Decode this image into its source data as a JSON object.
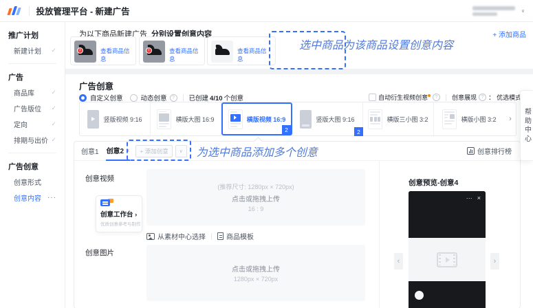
{
  "colors": {
    "accent": "#3370ff",
    "annotation": "#4f7bdf",
    "badge_orange": "#ff8800"
  },
  "icons": {
    "check": "✓",
    "caret_down": "∨",
    "more": "···",
    "chevron_right": "›",
    "nav_left": "‹",
    "nav_right": "›",
    "dots": "···",
    "close": "×",
    "info": "?"
  },
  "header": {
    "title": "投放管理平台 - 新建广告"
  },
  "sidebar": {
    "sections": [
      {
        "header": "推广计划",
        "items": [
          {
            "label": "新建计划"
          }
        ]
      },
      {
        "header": "广告",
        "items": [
          {
            "label": "商品库"
          },
          {
            "label": "广告版位"
          },
          {
            "label": "定向"
          },
          {
            "label": "排期与出价"
          }
        ]
      },
      {
        "header": "广告创意",
        "items": [
          {
            "label": "创意形式"
          },
          {
            "label": "创意内容"
          }
        ]
      }
    ]
  },
  "products": {
    "intro": "为以下商品新建广告",
    "intro_bold": "分别设置创意内容",
    "add_button": "+ 添加商品",
    "view_info": "查看商品信息"
  },
  "annotations": {
    "select_product": "选中商品为该商品设置创意内容",
    "add_creative": "为选中商品添加多个创意"
  },
  "creative": {
    "title": "广告创意",
    "radio_custom": "自定义创意",
    "radio_dynamic": "动态创意",
    "created_prefix": "已创建",
    "created_count": "4/10",
    "created_suffix": "个创意",
    "derive_checkbox": "自动衍生视频创意",
    "display_label": "创意展现",
    "display_colon": "：",
    "display_mode": "优选模式",
    "templates": [
      {
        "label": "竖版视频 9:16"
      },
      {
        "label": "横版大图 16:9"
      },
      {
        "label": "横版视频 16:9",
        "badge": "2"
      },
      {
        "label": "竖版大图 9:16",
        "badge": "2"
      },
      {
        "label": "横版三小图 3:2"
      },
      {
        "label": "横版小图 3:2"
      }
    ]
  },
  "creative_editor": {
    "tab1": "创意1",
    "tab2": "创意2",
    "add_button": "+ 添加创意",
    "ranking": "创意排行榜",
    "video_label": "创意视频",
    "video_size_hint": "(推荐尺寸: 1280px × 720px)",
    "video_upload": "点击或拖拽上传",
    "video_ratio": "16 : 9",
    "workbench": "创意工作台 ›",
    "workbench_sub": "优质创意参考与制作",
    "material_link": "从素材中心选择",
    "template_link": "商品模板",
    "image_label": "创意图片",
    "image_upload": "点击或拖拽上传",
    "image_size": "1280px × 720px"
  },
  "preview": {
    "title": "创意预览-创意4"
  },
  "help_tab": "帮助中心"
}
